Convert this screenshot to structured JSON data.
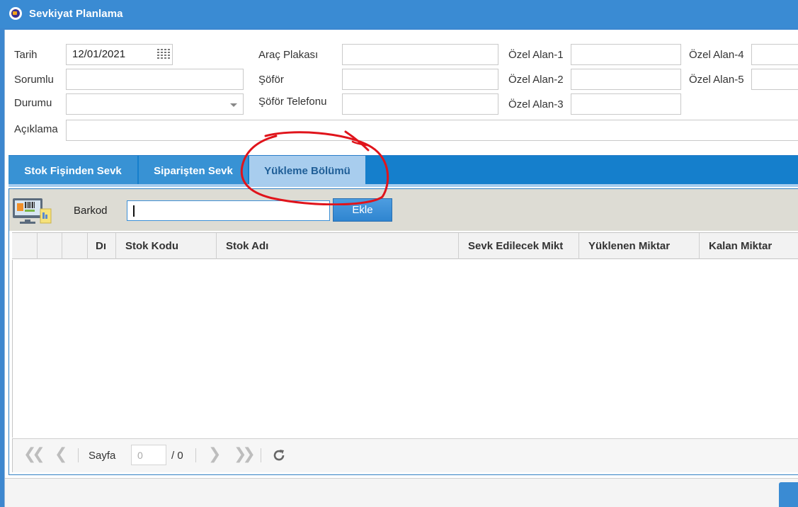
{
  "window": {
    "title": "Sevkiyat Planlama"
  },
  "form": {
    "tarih_label": "Tarih",
    "tarih_value": "12/01/2021",
    "sorumlu_label": "Sorumlu",
    "sorumlu_value": "",
    "durumu_label": "Durumu",
    "durumu_value": "",
    "aciklama_label": "Açıklama",
    "aciklama_value": "",
    "arac_plakasi_label": "Araç Plakası",
    "arac_plakasi_value": "",
    "sofor_label": "Şöför",
    "sofor_value": "",
    "sofor_telefonu_label": "Şöför Telefonu",
    "sofor_telefonu_value": "",
    "ozel_alan_1_label": "Özel Alan-1",
    "ozel_alan_1_value": "",
    "ozel_alan_2_label": "Özel Alan-2",
    "ozel_alan_2_value": "",
    "ozel_alan_3_label": "Özel Alan-3",
    "ozel_alan_3_value": "",
    "ozel_alan_4_label": "Özel Alan-4",
    "ozel_alan_4_value": "",
    "ozel_alan_5_label": "Özel Alan-5",
    "ozel_alan_5_value": ""
  },
  "tabs": [
    {
      "label": "Stok Fişinden Sevk",
      "active": false
    },
    {
      "label": "Siparişten Sevk",
      "active": false
    },
    {
      "label": "Yükleme Bölümü",
      "active": true
    }
  ],
  "toolbar": {
    "barkod_label": "Barkod",
    "barkod_value": "",
    "ekle_label": "Ekle"
  },
  "grid": {
    "columns": [
      "",
      "",
      "",
      "Dı",
      "Stok Kodu",
      "Stok Adı",
      "Sevk Edilecek Mikt",
      "Yüklenen Miktar",
      "Kalan Miktar"
    ],
    "rows": []
  },
  "pager": {
    "page_label": "Sayfa",
    "page_value": "0",
    "total_label": "/ 0"
  },
  "icons": {
    "first": "first-page-icon",
    "prev": "prev-page-icon",
    "next": "next-page-icon",
    "last": "last-page-icon",
    "refresh": "refresh-icon",
    "calendar": "calendar-icon",
    "pos": "pos-terminal-icon"
  },
  "colors": {
    "titlebar": "#3a8bd3",
    "tabstrip": "#157fcc",
    "active_tab": "#a8cdee",
    "annotation": "#e0141b"
  }
}
